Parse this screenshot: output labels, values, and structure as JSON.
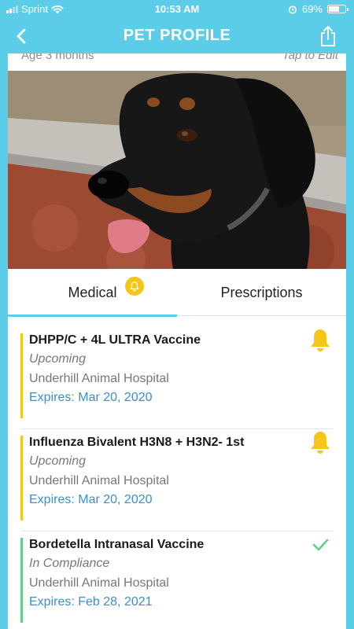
{
  "status_bar": {
    "carrier": "Sprint",
    "time": "10:53 AM",
    "battery_percent": "69%",
    "battery_level": 0.69
  },
  "nav": {
    "title": "PET PROFILE",
    "back_icon": "chevron-left-icon",
    "share_icon": "share-icon"
  },
  "profile": {
    "age": "Age 3 months",
    "tap_to_edit": "Tap to Edit"
  },
  "tabs": [
    {
      "label": "Medical",
      "active": true,
      "badge_icon": "bell-icon"
    },
    {
      "label": "Prescriptions",
      "active": false
    }
  ],
  "records": [
    {
      "name": "DHPP/C + 4L ULTRA Vaccine",
      "status": "Upcoming",
      "clinic": "Underhill Animal Hospital",
      "expires": "Expires: Mar 20, 2020",
      "icon": "bell-icon",
      "accent": "#f5c518"
    },
    {
      "name": "Influenza Bivalent H3N8 + H3N2- 1st",
      "status": "Upcoming",
      "clinic": "Underhill Animal Hospital",
      "expires": "Expires: Mar 20, 2020",
      "icon": "bell-icon",
      "accent": "#f5c518"
    },
    {
      "name": "Bordetella Intranasal Vaccine",
      "status": "In Compliance",
      "clinic": "Underhill Animal Hospital",
      "expires": "Expires: Feb 28, 2021",
      "icon": "check-icon",
      "accent": "#5fcf8a"
    }
  ],
  "colors": {
    "brand": "#5ccde8",
    "upcoming": "#f5c518",
    "compliance": "#5fcf8a",
    "link": "#3b8fc7"
  }
}
